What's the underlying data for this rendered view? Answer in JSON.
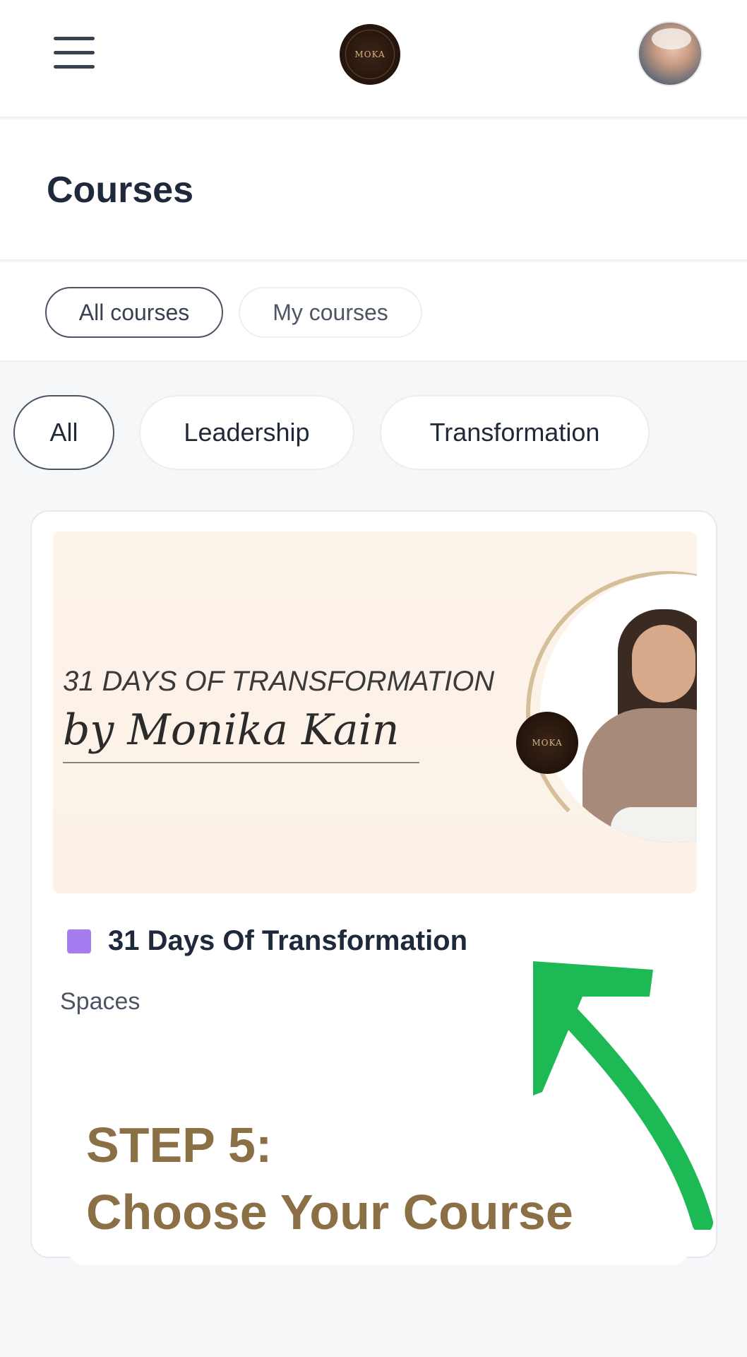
{
  "header": {
    "logo_text": "MOKA",
    "menu_icon": "hamburger-menu-icon",
    "avatar_icon": "user-avatar"
  },
  "page": {
    "title": "Courses"
  },
  "tabs": [
    {
      "label": "All courses",
      "active": true
    },
    {
      "label": "My courses",
      "active": false
    }
  ],
  "categories": [
    {
      "label": "All",
      "active": true
    },
    {
      "label": "Leadership",
      "active": false
    },
    {
      "label": "Transformation",
      "active": false
    }
  ],
  "course": {
    "banner_title": "31 DAYS OF TRANSFORMATION",
    "banner_subtitle": "by Monika Kain",
    "banner_logo_text": "MOKA",
    "title": "31 Days Of Transformation",
    "space": "Spaces",
    "color_tag": "#a47cf0"
  },
  "annotation": {
    "step": "STEP 5:",
    "instruction": "Choose Your Course",
    "text_color": "#8c7045",
    "arrow_color": "#1db954"
  }
}
